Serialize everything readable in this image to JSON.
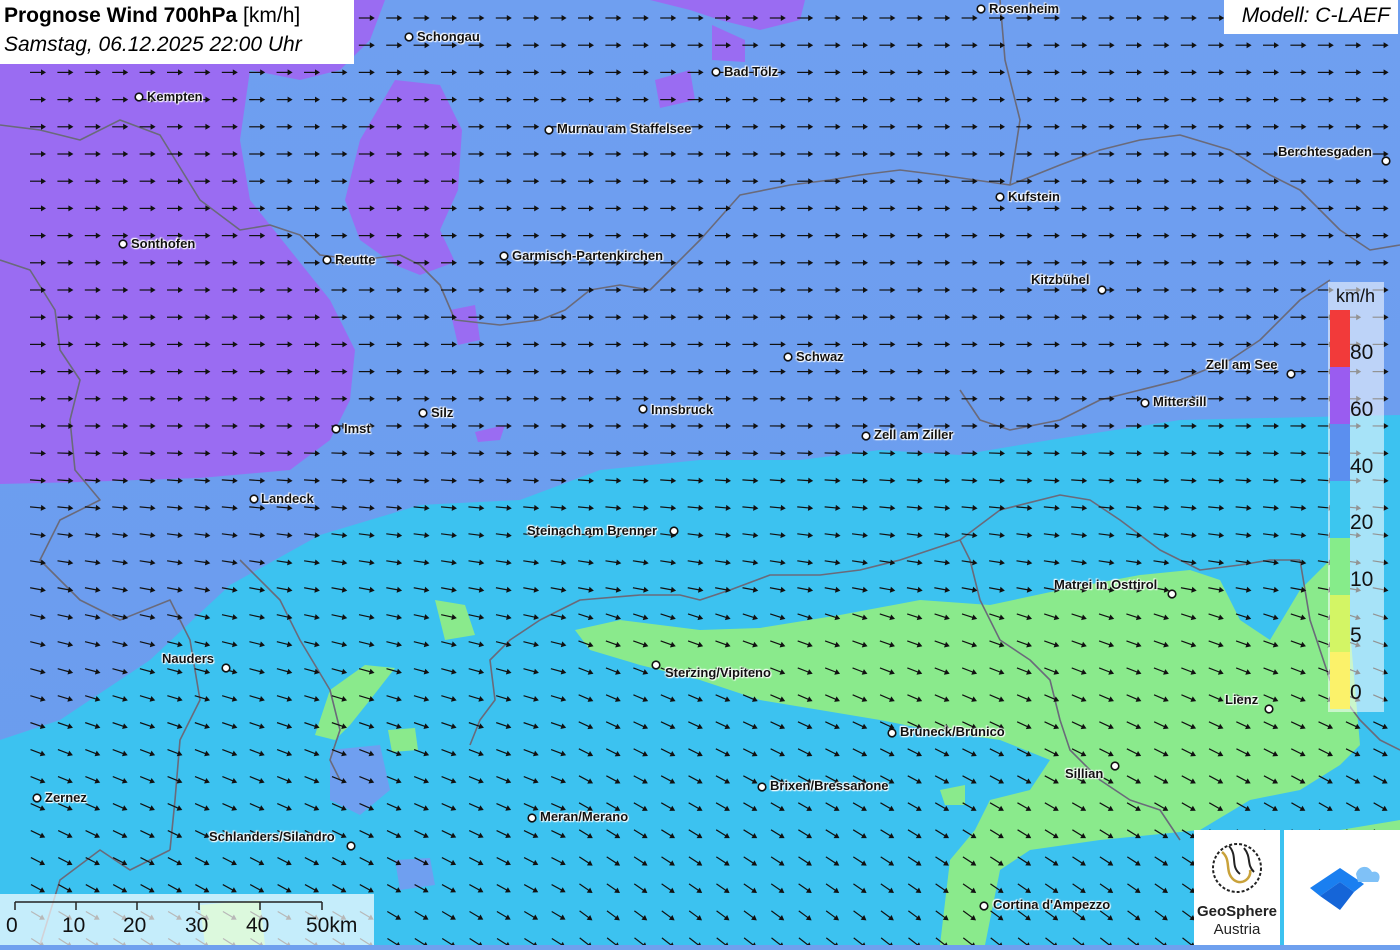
{
  "header": {
    "title": "Prognose Wind 700hPa",
    "unit_label": "[km/h]",
    "datetime": "Samstag, 06.12.2025 22:00 Uhr"
  },
  "model": {
    "label": "Modell: C-LAEF"
  },
  "legend": {
    "unit": "km/h",
    "classes": [
      {
        "from": 80,
        "color": "#f23a3a"
      },
      {
        "from": 60,
        "color": "#9a5cf0"
      },
      {
        "from": 40,
        "color": "#5b8fef"
      },
      {
        "from": 20,
        "color": "#3cc6ef"
      },
      {
        "from": 10,
        "color": "#86ec8a"
      },
      {
        "from": 5,
        "color": "#d3f565"
      },
      {
        "from": 0,
        "color": "#fbf26a"
      }
    ],
    "tick_labels": [
      "80",
      "60",
      "40",
      "20",
      "10",
      "5",
      "0"
    ]
  },
  "scalebar": {
    "labels": [
      "0",
      "10",
      "20",
      "30",
      "40",
      "50km"
    ]
  },
  "logos": {
    "geosphere_line1": "GeoSphere",
    "geosphere_line2": "Austria"
  },
  "cities": [
    {
      "name": "Rosenheim"
    },
    {
      "name": "Schongau"
    },
    {
      "name": "Bad Tölz"
    },
    {
      "name": "Kempten"
    },
    {
      "name": "Murnau am Staffelsee"
    },
    {
      "name": "Berchtesgaden"
    },
    {
      "name": "Kufstein"
    },
    {
      "name": "Sonthofen"
    },
    {
      "name": "Reutte"
    },
    {
      "name": "Garmisch-Partenkirchen"
    },
    {
      "name": "Kitzbühel"
    },
    {
      "name": "Schwaz"
    },
    {
      "name": "Zell am See"
    },
    {
      "name": "Mittersill"
    },
    {
      "name": "Silz"
    },
    {
      "name": "Innsbruck"
    },
    {
      "name": "Imst"
    },
    {
      "name": "Zell am Ziller"
    },
    {
      "name": "Landeck"
    },
    {
      "name": "Steinach am Brenner"
    },
    {
      "name": "Matrei in Osttirol"
    },
    {
      "name": "Nauders"
    },
    {
      "name": "Sterzing/Vipiteno"
    },
    {
      "name": "Lienz"
    },
    {
      "name": "Bruneck/Brunico"
    },
    {
      "name": "Sillian"
    },
    {
      "name": "Brixen/Bressanone"
    },
    {
      "name": "Zernez"
    },
    {
      "name": "Meran/Merano"
    },
    {
      "name": "Schlanders/Silandro"
    },
    {
      "name": "Cortina d'Ampezzo"
    }
  ]
}
